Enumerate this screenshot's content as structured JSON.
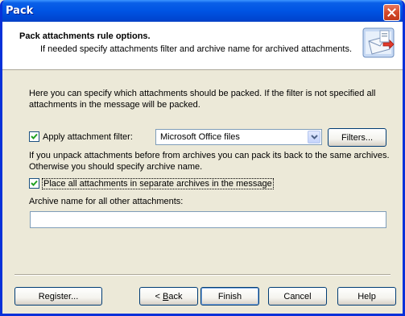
{
  "window": {
    "title": "Pack"
  },
  "header": {
    "title": "Pack attachments rule options.",
    "subtitle": "If needed specify attachments filter and archive name for archived attachments.",
    "icon": "envelope-document-icon"
  },
  "intro": {
    "text": "Here you can specify which attachments should be packed. If the filter is not specified all attachments in the message will be packed."
  },
  "filter": {
    "checked": true,
    "label": "Apply attachment filter:",
    "selected": "Microsoft Office files",
    "button_label": "Filters..."
  },
  "unpack": {
    "text": "If you unpack attachments before from archives you can pack its back to the same archives. Otherwise you should specify archive name."
  },
  "separate": {
    "checked": true,
    "label": "Place all attachments in separate archives in the message"
  },
  "archive": {
    "label": "Archive name for all other attachments:",
    "value": ""
  },
  "buttons": {
    "register": "Register...",
    "back_prefix": "< ",
    "back_accel": "B",
    "back_rest": "ack",
    "finish": "Finish",
    "cancel": "Cancel",
    "help": "Help"
  }
}
